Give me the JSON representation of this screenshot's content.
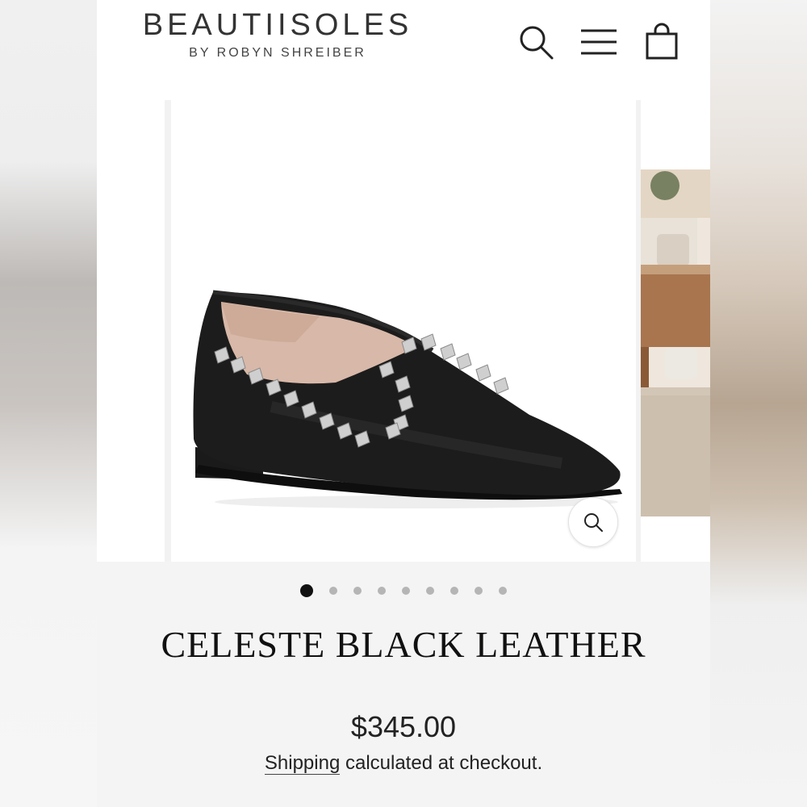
{
  "brand": {
    "name": "BEAUTIISOLES",
    "byline": "BY ROBYN SHREIBER"
  },
  "header_icons": [
    "search-icon",
    "menu-icon",
    "cart-icon"
  ],
  "gallery": {
    "slide_count": 9,
    "active_index": 0,
    "main_image": "black studded pointed-toe loafer",
    "next_image": "living room interior",
    "zoom_icon": "zoom-icon"
  },
  "product": {
    "title": "CELESTE BLACK LEATHER",
    "price": "$345.00",
    "shipping_link": "Shipping",
    "shipping_rest": " calculated at checkout."
  },
  "colors": {
    "text": "#111111",
    "header_bg": "#ffffff",
    "page_bg": "#f4f4f5",
    "dot_active": "#111111",
    "dot_inactive": "#b5b5b5"
  }
}
